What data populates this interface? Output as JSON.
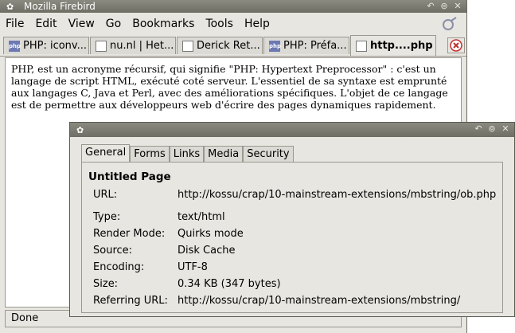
{
  "window": {
    "title": "Mozilla Firebird"
  },
  "menu": [
    {
      "label": "File"
    },
    {
      "label": "Edit"
    },
    {
      "label": "View"
    },
    {
      "label": "Go"
    },
    {
      "label": "Bookmarks"
    },
    {
      "label": "Tools"
    },
    {
      "label": "Help"
    }
  ],
  "tabs": [
    {
      "label": "PHP: iconv..."
    },
    {
      "label": "nu.nl | Het..."
    },
    {
      "label": "Derick Ret..."
    },
    {
      "label": "PHP: Préfa..."
    },
    {
      "label": "http....php"
    }
  ],
  "content": {
    "text": "PHP, est un acronyme récursif, qui signifie \"PHP: Hypertext Preprocessor\" : c'est un langage de script HTML, exécuté coté serveur. L'essentiel de sa syntaxe est emprunté aux langages C, Java et Perl, avec des améliorations spécifiques. L'objet de ce langage est de permettre aux développeurs web d'écrire des pages dynamiques rapidement."
  },
  "status": {
    "text": "Done"
  },
  "dialog": {
    "tabs": [
      {
        "label": "General"
      },
      {
        "label": "Forms"
      },
      {
        "label": "Links"
      },
      {
        "label": "Media"
      },
      {
        "label": "Security"
      }
    ],
    "page_title": "Untitled Page",
    "url_label": "URL:",
    "url": "http://kossu/crap/10-mainstream-extensions/mbstring/ob.php",
    "fields": [
      {
        "label": "Type:",
        "value": "text/html"
      },
      {
        "label": "Render Mode:",
        "value": "Quirks mode"
      },
      {
        "label": "Source:",
        "value": "Disk Cache"
      },
      {
        "label": "Encoding:",
        "value": "UTF-8"
      },
      {
        "label": "Size:",
        "value": "0.34 KB (347 bytes)"
      },
      {
        "label": "Referring URL:",
        "value": "http://kossu/crap/10-mainstream-extensions/mbstring/"
      }
    ]
  },
  "colors": {
    "titlebar": "#7b7a70",
    "chrome": "#e8e6e1",
    "favicon_php": "#6d79b4",
    "close_red": "#c03030"
  }
}
